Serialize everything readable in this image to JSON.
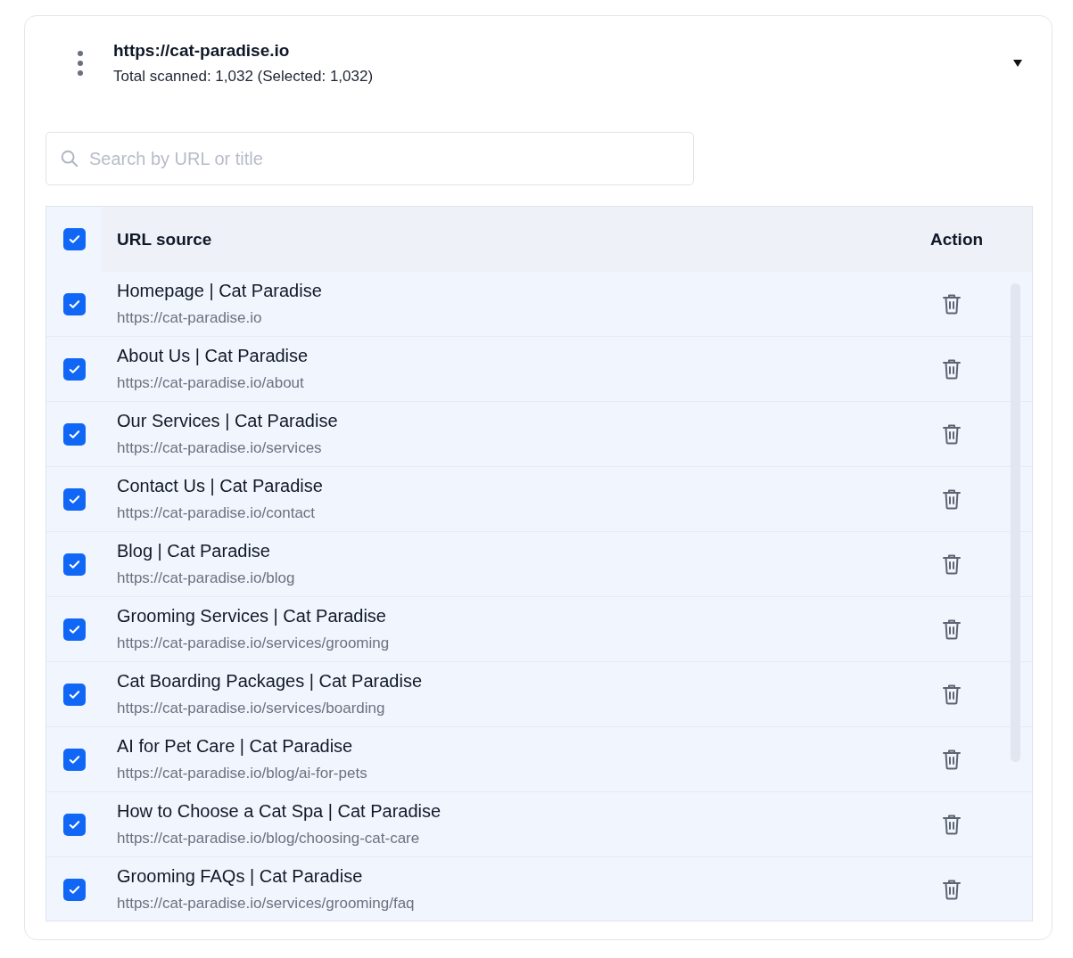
{
  "site": {
    "url": "https://cat-paradise.io",
    "summary": "Total scanned: 1,032 (Selected: 1,032)",
    "expanded": true
  },
  "search": {
    "placeholder": "Search by URL or title"
  },
  "table": {
    "select_all": {
      "checked": true
    },
    "columns": [
      "URL source",
      "Action"
    ],
    "rows": [
      {
        "title": "Homepage | Cat Paradise",
        "url": "https://cat-paradise.io",
        "checked": true
      },
      {
        "title": "About Us | Cat Paradise",
        "url": "https://cat-paradise.io/about",
        "checked": true
      },
      {
        "title": "Our Services | Cat Paradise",
        "url": "https://cat-paradise.io/services",
        "checked": true
      },
      {
        "title": "Contact Us | Cat Paradise",
        "url": "https://cat-paradise.io/contact",
        "checked": true
      },
      {
        "title": "Blog | Cat Paradise",
        "url": "https://cat-paradise.io/blog",
        "checked": true
      },
      {
        "title": "Grooming Services | Cat Paradise",
        "url": "https://cat-paradise.io/services/grooming",
        "checked": true
      },
      {
        "title": "Cat Boarding Packages | Cat Paradise",
        "url": "https://cat-paradise.io/services/boarding",
        "checked": true
      },
      {
        "title": "AI for Pet Care | Cat Paradise",
        "url": "https://cat-paradise.io/blog/ai-for-pets",
        "checked": true
      },
      {
        "title": "How to Choose a Cat Spa | Cat Paradise",
        "url": "https://cat-paradise.io/blog/choosing-cat-care",
        "checked": true
      },
      {
        "title": "Grooming FAQs | Cat Paradise",
        "url": "https://cat-paradise.io/services/grooming/faq",
        "checked": true
      }
    ]
  }
}
